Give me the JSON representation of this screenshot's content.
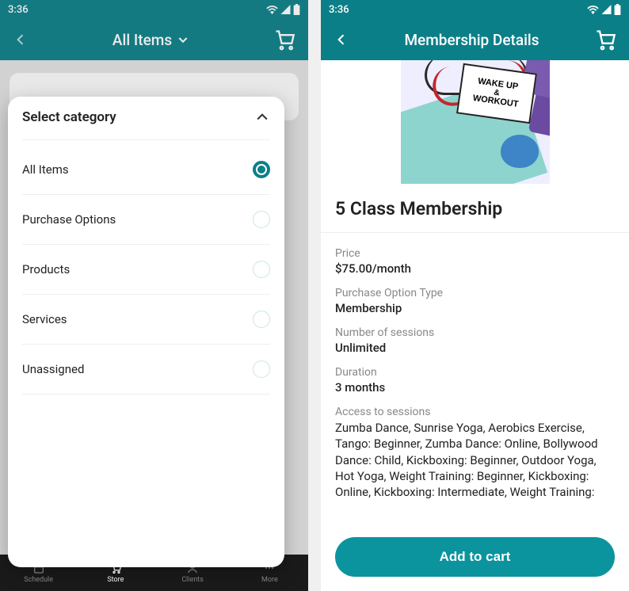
{
  "status": {
    "time": "3:36"
  },
  "screen1": {
    "appbar": {
      "title": "All Items"
    },
    "sheet": {
      "header": "Select category",
      "categories": [
        {
          "label": "All Items",
          "selected": true
        },
        {
          "label": "Purchase Options",
          "selected": false
        },
        {
          "label": "Products",
          "selected": false
        },
        {
          "label": "Services",
          "selected": false
        },
        {
          "label": "Unassigned",
          "selected": false
        }
      ]
    },
    "nav": {
      "items": [
        {
          "label": "Schedule"
        },
        {
          "label": "Store"
        },
        {
          "label": "Clients"
        },
        {
          "label": "More"
        }
      ]
    }
  },
  "screen2": {
    "appbar": {
      "title": "Membership Details"
    },
    "product": {
      "name": "5 Class Membership",
      "sign_line1": "WAKE UP",
      "sign_line2": "&",
      "sign_line3": "WORKOUT",
      "fields": {
        "price_label": "Price",
        "price_value": "$75.00/month",
        "type_label": "Purchase Option Type",
        "type_value": "Membership",
        "sessions_label": "Number of sessions",
        "sessions_value": "Unlimited",
        "duration_label": "Duration",
        "duration_value": "3 months",
        "access_label": "Access to sessions",
        "access_value": "Zumba Dance, Sunrise Yoga, Aerobics Exercise, Tango: Beginner, Zumba Dance: Online, Bollywood Dance: Child, Kickboxing: Beginner, Outdoor Yoga, Hot Yoga, Weight Training: Beginner, Kickboxing: Online, Kickboxing: Intermediate, Weight Training:"
      },
      "cta": "Add to cart"
    }
  }
}
